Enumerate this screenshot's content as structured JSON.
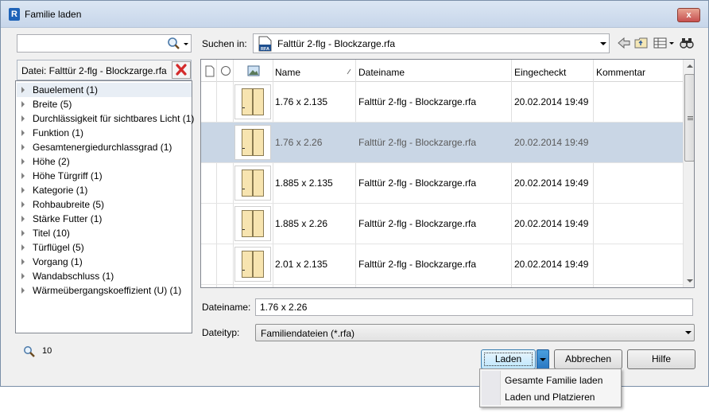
{
  "window": {
    "title": "Familie laden",
    "app_icon_letter": "R",
    "close_label": "x"
  },
  "search": {
    "value": "",
    "placeholder": ""
  },
  "file_filter": {
    "label": "Datei: Falttür 2-flg - Blockzarge.rfa"
  },
  "facets": [
    {
      "label": "Bauelement (1)"
    },
    {
      "label": "Breite (5)"
    },
    {
      "label": "Durchlässigkeit für sichtbares Licht (1)"
    },
    {
      "label": "Funktion (1)"
    },
    {
      "label": "Gesamtenergiedurchlassgrad (1)"
    },
    {
      "label": "Höhe (2)"
    },
    {
      "label": "Höhe Türgriff (1)"
    },
    {
      "label": "Kategorie (1)"
    },
    {
      "label": "Rohbaubreite (5)"
    },
    {
      "label": "Stärke Futter (1)"
    },
    {
      "label": "Titel (10)"
    },
    {
      "label": "Türflügel (5)"
    },
    {
      "label": "Vorgang (1)"
    },
    {
      "label": "Wandabschluss (1)"
    },
    {
      "label": "Wärmeübergangskoeffizient (U) (1)"
    }
  ],
  "results": {
    "count": "10"
  },
  "look_in": {
    "label": "Suchen in:",
    "value": "Falttür 2-flg - Blockzarge.rfa",
    "icon_text": "RFA"
  },
  "grid": {
    "columns": {
      "name": "Name",
      "filename": "Dateiname",
      "checkedin": "Eingecheckt",
      "comment": "Kommentar"
    },
    "rows": [
      {
        "name": "1.76 x 2.135",
        "filename": "Falttür 2-flg - Blockzarge.rfa",
        "checkedin": "20.02.2014 19:49",
        "comment": ""
      },
      {
        "name": "1.76 x 2.26",
        "filename": "Falttür 2-flg - Blockzarge.rfa",
        "checkedin": "20.02.2014 19:49",
        "comment": ""
      },
      {
        "name": "1.885 x 2.135",
        "filename": "Falttür 2-flg - Blockzarge.rfa",
        "checkedin": "20.02.2014 19:49",
        "comment": ""
      },
      {
        "name": "1.885 x 2.26",
        "filename": "Falttür 2-flg - Blockzarge.rfa",
        "checkedin": "20.02.2014 19:49",
        "comment": ""
      },
      {
        "name": "2.01 x 2.135",
        "filename": "Falttür 2-flg - Blockzarge.rfa",
        "checkedin": "20.02.2014 19:49",
        "comment": ""
      }
    ]
  },
  "filename_field": {
    "label": "Dateiname:",
    "value": "1.76 x 2.26"
  },
  "filetype_field": {
    "label": "Dateityp:",
    "value": "Familiendateien (*.rfa)"
  },
  "buttons": {
    "load": "Laden",
    "cancel": "Abbrechen",
    "help": "Hilfe"
  },
  "load_menu": {
    "items": [
      {
        "label": "Gesamte Familie laden"
      },
      {
        "label": "Laden und Platzieren"
      }
    ]
  },
  "colors": {
    "selection": "#c9d6e5",
    "accent": "#3c7fb1",
    "door_fill": "#f7e4b0",
    "remove_icon": "#d42b2b"
  }
}
